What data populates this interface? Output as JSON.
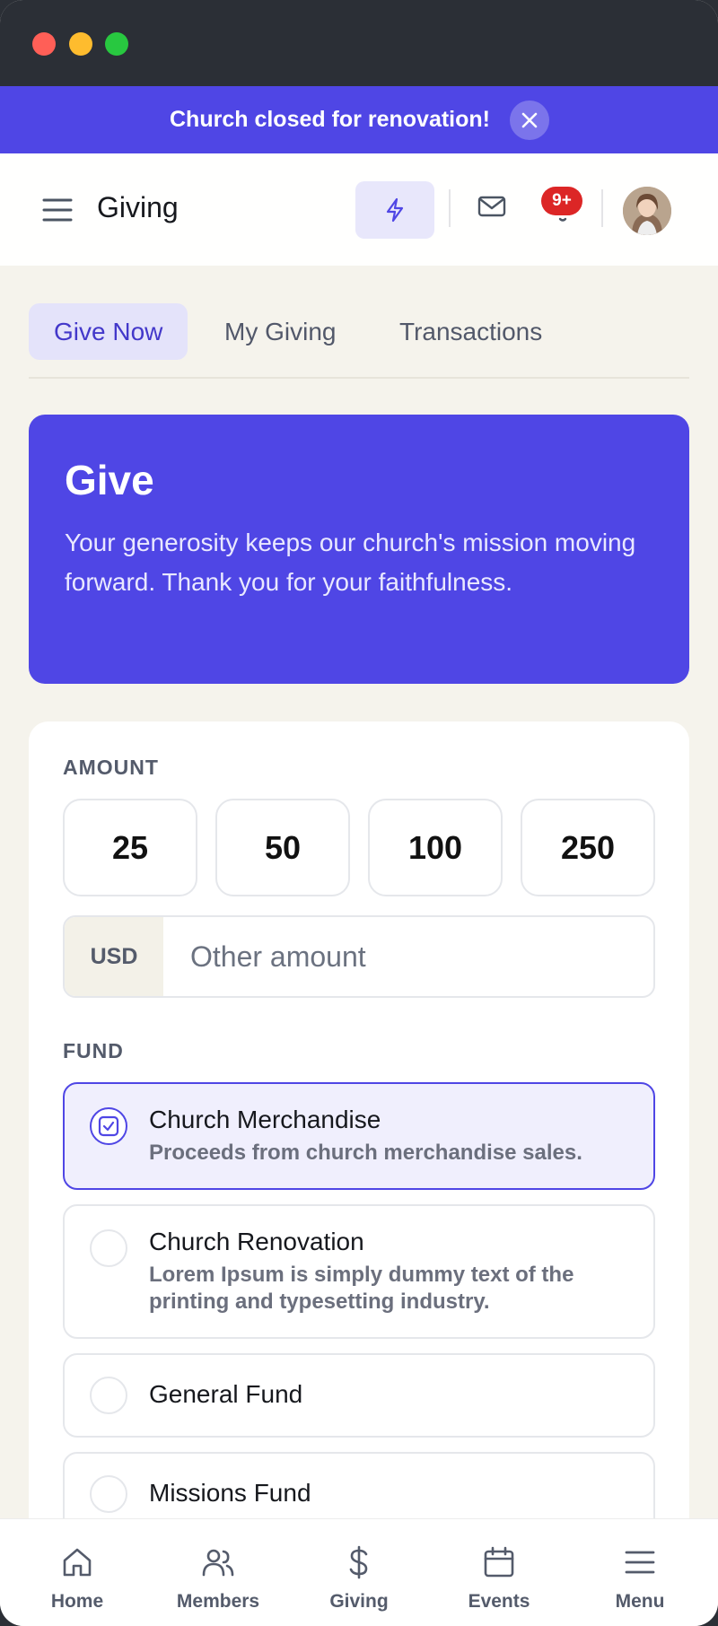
{
  "banner": {
    "message": "Church closed for renovation!"
  },
  "header": {
    "title": "Giving",
    "notification_badge": "9+"
  },
  "tabs": [
    {
      "label": "Give Now",
      "active": true
    },
    {
      "label": "My Giving",
      "active": false
    },
    {
      "label": "Transactions",
      "active": false
    }
  ],
  "hero": {
    "title": "Give",
    "text": "Your generosity keeps our church's mission moving forward. Thank you for your faithfulness."
  },
  "giving_form": {
    "amount_label": "AMOUNT",
    "amount_options": [
      "25",
      "50",
      "100",
      "250"
    ],
    "currency": "USD",
    "other_amount_placeholder": "Other amount",
    "fund_label": "FUND",
    "funds": [
      {
        "name": "Church Merchandise",
        "description": "Proceeds from church merchandise sales.",
        "selected": true
      },
      {
        "name": "Church Renovation",
        "description": "Lorem Ipsum is simply dummy text of the printing and typesetting industry.",
        "selected": false
      },
      {
        "name": "General Fund",
        "description": "",
        "selected": false
      },
      {
        "name": "Missions Fund",
        "description": "",
        "selected": false
      }
    ]
  },
  "bottom_nav": [
    {
      "label": "Home",
      "icon": "home-icon"
    },
    {
      "label": "Members",
      "icon": "members-icon"
    },
    {
      "label": "Giving",
      "icon": "dollar-icon"
    },
    {
      "label": "Events",
      "icon": "calendar-icon"
    },
    {
      "label": "Menu",
      "icon": "menu-icon"
    }
  ],
  "colors": {
    "accent": "#4f46e5",
    "badge": "#dc2626",
    "background": "#f5f3ec"
  }
}
